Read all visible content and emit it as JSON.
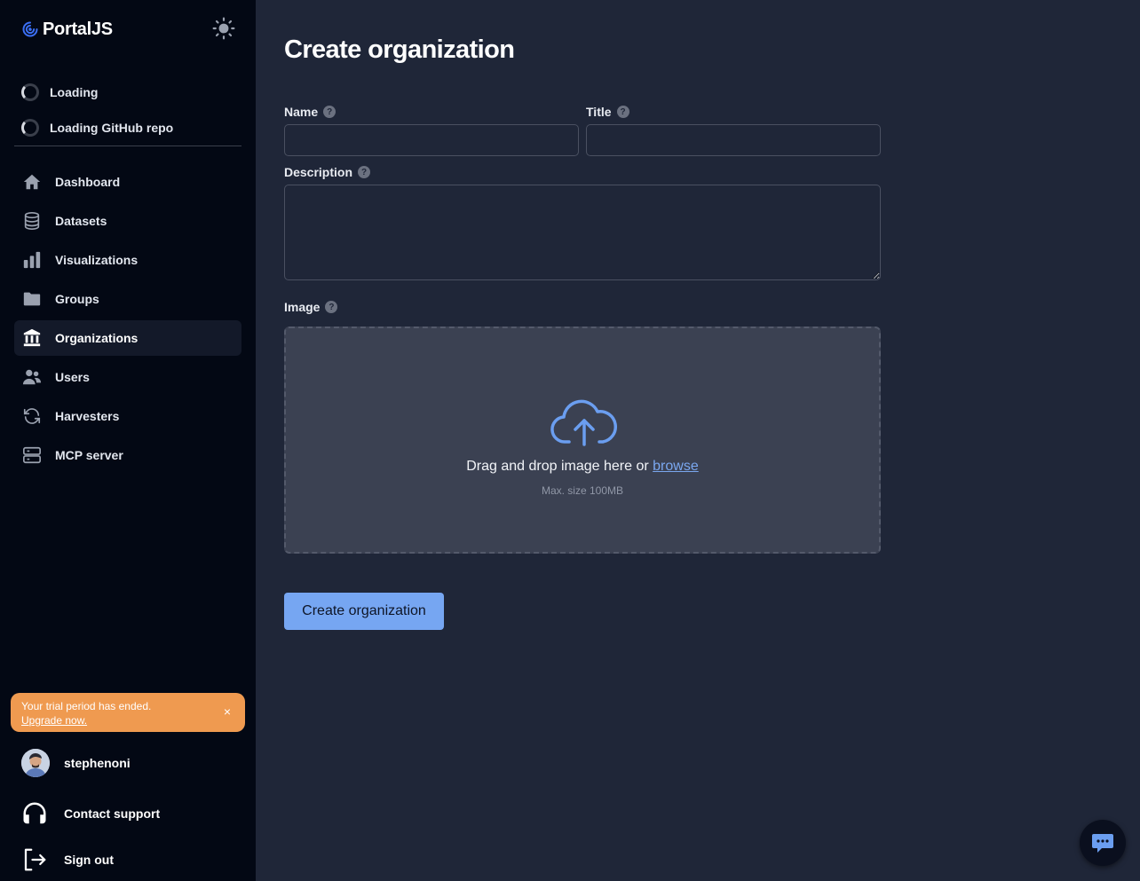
{
  "brand": {
    "name": "PortalJS"
  },
  "loading": [
    {
      "label": "Loading"
    },
    {
      "label": "Loading GitHub repo"
    }
  ],
  "sidebar": {
    "items": [
      {
        "label": "Dashboard",
        "icon": "home-icon"
      },
      {
        "label": "Datasets",
        "icon": "database-icon"
      },
      {
        "label": "Visualizations",
        "icon": "bar-chart-icon"
      },
      {
        "label": "Groups",
        "icon": "folder-icon"
      },
      {
        "label": "Organizations",
        "icon": "bank-icon",
        "active": true
      },
      {
        "label": "Users",
        "icon": "users-icon"
      },
      {
        "label": "Harvesters",
        "icon": "refresh-icon"
      },
      {
        "label": "MCP server",
        "icon": "server-icon"
      }
    ]
  },
  "trial": {
    "message": "Your trial period has ended.",
    "upgrade": "Upgrade now.",
    "close": "×"
  },
  "user": {
    "name": "stephenoni"
  },
  "support": {
    "label": "Contact support"
  },
  "signout": {
    "label": "Sign out"
  },
  "form": {
    "title": "Create organization",
    "name_label": "Name",
    "title_label": "Title",
    "description_label": "Description",
    "image_label": "Image",
    "help": "?",
    "drop_text": "Drag and drop image here or",
    "browse": "browse",
    "max_size": "Max. size 100MB",
    "submit": "Create organization"
  },
  "colors": {
    "sidebar_bg": "#030814",
    "main_bg": "#1f2638",
    "accent": "#76a6f2",
    "trial_bg": "#ef9a50",
    "brand_icon": "#3b6ff5"
  }
}
